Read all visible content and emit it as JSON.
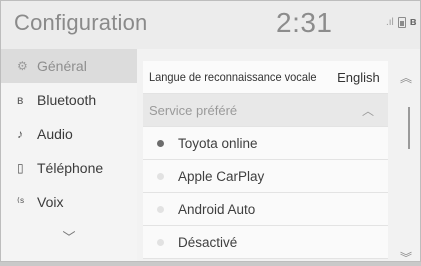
{
  "header": {
    "title": "Configuration",
    "time": "2:31",
    "signal_glyph": ".ıl"
  },
  "sidebar": {
    "items": [
      {
        "label": "Général",
        "icon": "gear-icon",
        "glyph": "⚙"
      },
      {
        "label": "Bluetooth",
        "icon": "bluetooth-icon",
        "glyph": "ʙ"
      },
      {
        "label": "Audio",
        "icon": "music-note-icon",
        "glyph": "♪"
      },
      {
        "label": "Téléphone",
        "icon": "phone-icon",
        "glyph": "▯"
      },
      {
        "label": "Voix",
        "icon": "voice-icon",
        "glyph": "⁽ˢ"
      }
    ],
    "more_glyph": "﹀"
  },
  "main": {
    "language_label": "Langue de reconnaissance vocale",
    "language_value": "English",
    "section_label": "Service préféré",
    "section_chevron": "︿",
    "options": [
      {
        "label": "Toyota online",
        "selected": true
      },
      {
        "label": "Apple CarPlay",
        "selected": false
      },
      {
        "label": "Android Auto",
        "selected": false
      },
      {
        "label": "Désactivé",
        "selected": false
      }
    ]
  },
  "scroll": {
    "up_glyph": "︽",
    "down_glyph": "︾"
  }
}
